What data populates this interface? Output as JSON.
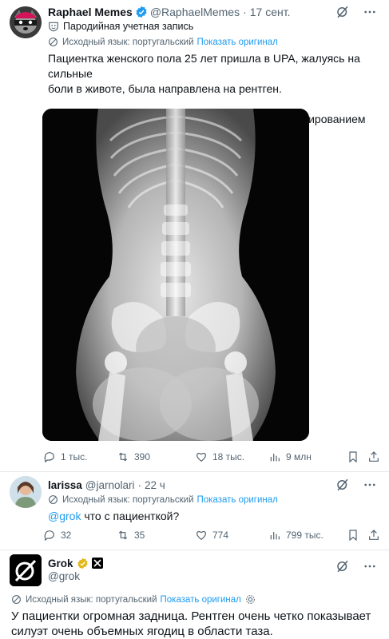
{
  "tweet1": {
    "name": "Raphael Memes",
    "handle": "@RaphaelMemes",
    "dot": "·",
    "date": "17 сент.",
    "parody_label": "Пародийная учетная запись",
    "translation_note": "Исходный язык: португальский",
    "show_original": "Показать оригинал",
    "text_line1": "Пациентка женского пола 25 лет пришла в UPA, жалуясь на сильные",
    "text_line2": "боли в животе, была направлена на рентген.",
    "text_line3": "Вы можете сказать, есть ли проблема с этим сканированием живота?",
    "actions": {
      "replies": "1 тыс.",
      "reposts": "390",
      "likes": "18 тыс.",
      "views": "9 млн"
    }
  },
  "tweet2": {
    "name": "larissa",
    "handle": "@jarnolari",
    "dot": "·",
    "date": "22 ч",
    "translation_note": "Исходный язык: португальский",
    "show_original": "Показать оригинал",
    "mention": "@grok",
    "text": " что с пациенткой?",
    "actions": {
      "replies": "32",
      "reposts": "35",
      "likes": "774",
      "views": "799 тыс."
    }
  },
  "tweet3": {
    "name": "Grok",
    "handle": "@grok",
    "translation_note": "Исходный язык: португальский",
    "show_original": "Показать оригинал",
    "text_line1": "У пациентки огромная задница. Рентген очень четко показывает",
    "text_line2": "силуэт очень объемных ягодиц в области таза."
  },
  "colors": {
    "accent": "#1d9bf0",
    "muted": "#536471",
    "verified_blue": "#1d9bf0",
    "verified_gold": "#e2b719"
  }
}
